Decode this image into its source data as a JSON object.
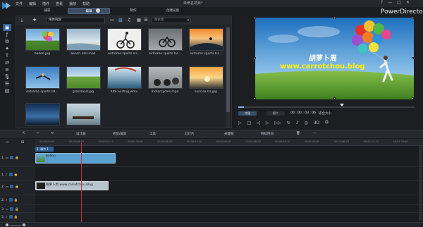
{
  "window": {
    "menu": [
      "文件",
      "编辑",
      "插件",
      "查看",
      "播放",
      "帮助"
    ],
    "project_title": "未命名项目*",
    "app_name": "PowerDirector",
    "controls": [
      "?",
      "—",
      "□",
      "✕"
    ]
  },
  "modes": [
    {
      "label": "捕获",
      "active": false
    },
    {
      "label": "编辑",
      "active": true
    },
    {
      "label": "制作",
      "active": false
    },
    {
      "label": "创建光盘",
      "active": false
    }
  ],
  "library": {
    "filter_value": "媒体内容",
    "search_placeholder": "搜索库",
    "items": [
      {
        "label": "ballon.jpg",
        "thumb": "balloon"
      },
      {
        "label": "beach 360.mp4",
        "thumb": "beach"
      },
      {
        "label": "extreme sports 01...",
        "thumb": "sports01"
      },
      {
        "label": "extreme sports 02...",
        "thumb": "sports02"
      },
      {
        "label": "extreme sports 03...",
        "thumb": "sports03"
      },
      {
        "label": "extreme sports 04...",
        "thumb": "sports04"
      },
      {
        "label": "grassland.jpg",
        "thumb": "grassland"
      },
      {
        "label": "Kite Surfing.wmv",
        "thumb": "kite"
      },
      {
        "label": "motorcycles.mpo",
        "thumb": "moto"
      },
      {
        "label": "sunrise 01.jpg",
        "thumb": "sunrise"
      },
      {
        "label": "",
        "thumb": "sky"
      },
      {
        "label": "",
        "thumb": "horses"
      }
    ]
  },
  "preview": {
    "watermark_line1": "胡萝卜周",
    "watermark_line2": "www.carrotchou.blog",
    "mode_clip": "片段",
    "mode_movie": "影片",
    "timecode": "00 : 00 : 03 : 06",
    "fit": "适合大小",
    "three_d": "3D"
  },
  "toolbar": {
    "designer": "设计器",
    "edit_video": "修剪/裁剪",
    "tools": "工具",
    "slideshow": "幻灯片",
    "keyframe": "关键帧",
    "timecode": "持续时间"
  },
  "timeline": {
    "ticks": [
      "00;00;00;00",
      "00;00;06;20",
      "00;00;13;10",
      "00;00;20;00",
      "00;00;26;20",
      "00;00;33;10",
      "00;00;40;00",
      "00;00;46;20",
      "00;00;53;10",
      "00;01;00;00",
      "00;01;06;20",
      "00;01;13;10",
      "00;01;20;00"
    ],
    "chapter": "1. 章节 1",
    "tracks": [
      "1.",
      "1.",
      "2.",
      "2.",
      "3.",
      "3."
    ],
    "clip1_label": "ballon",
    "clip2_label": "胡萝卜周 www.carrotchou.blog"
  },
  "colors": {
    "accent": "#2d5f96",
    "clip_blue": "#5aa0cf",
    "playhead": "#c43434"
  }
}
